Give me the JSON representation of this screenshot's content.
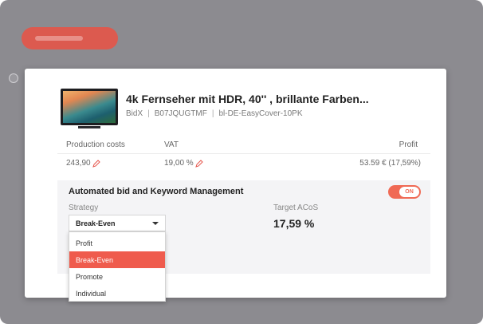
{
  "product": {
    "title": "4k Fernseher mit HDR, 40'' , brillante Farben...",
    "account": "BidX",
    "asin": "B07JQUGTMF",
    "campaign": "bl-DE-EasyCover-10PK"
  },
  "table": {
    "headers": {
      "production_costs": "Production costs",
      "vat": "VAT",
      "profit": "Profit"
    },
    "values": {
      "production_costs": "243,90",
      "vat": "19,00 %",
      "profit": "53.59 € (17,59%)"
    }
  },
  "automation": {
    "title": "Automated bid and Keyword Management",
    "toggle_label": "ON",
    "strategy_label": "Strategy",
    "strategy_value": "Break-Even",
    "target_acos_label": "Target ACoS",
    "target_acos_value": "17,59 %",
    "options": [
      "Profit",
      "Break-Even",
      "Promote",
      "Individual"
    ],
    "selected_index": 1
  },
  "colors": {
    "accent": "#ef5b4d",
    "toggle": "#f06a55",
    "backdrop": "#8c8b90"
  }
}
